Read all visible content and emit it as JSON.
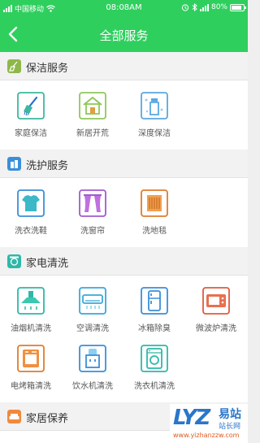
{
  "status_bar": {
    "carrier": "中国移动",
    "time": "08:08AM",
    "battery": "80%"
  },
  "header": {
    "title": "全部服务"
  },
  "sections": [
    {
      "title": "保洁服务",
      "icon": "broom-icon",
      "color": "#8fb84a",
      "items": [
        {
          "label": "家庭保洁",
          "icon": "broom-icon"
        },
        {
          "label": "新居开荒",
          "icon": "house-icon"
        },
        {
          "label": "深度保洁",
          "icon": "spray-bottle-icon"
        }
      ]
    },
    {
      "title": "洗护服务",
      "icon": "detergent-icon",
      "color": "#3a8fd8",
      "items": [
        {
          "label": "洗衣洗鞋",
          "icon": "shirt-icon"
        },
        {
          "label": "洗窗帘",
          "icon": "curtain-icon"
        },
        {
          "label": "洗地毯",
          "icon": "carpet-icon"
        }
      ]
    },
    {
      "title": "家电清洗",
      "icon": "washer-icon",
      "color": "#2fb8a8",
      "items": [
        {
          "label": "油烟机清洗",
          "icon": "range-hood-icon"
        },
        {
          "label": "空调清洗",
          "icon": "air-conditioner-icon"
        },
        {
          "label": "冰箱除臭",
          "icon": "fridge-icon"
        },
        {
          "label": "微波炉清洗",
          "icon": "microwave-icon"
        },
        {
          "label": "电烤箱清洗",
          "icon": "oven-icon"
        },
        {
          "label": "饮水机清洗",
          "icon": "water-dispenser-icon"
        },
        {
          "label": "洗衣机清洗",
          "icon": "washing-machine-icon"
        }
      ]
    },
    {
      "title": "家居保养",
      "icon": "sofa-icon",
      "color": "#f08a3c",
      "items": []
    }
  ],
  "watermark": {
    "logo": "LYZ",
    "name": "易站",
    "subtitle": "站长网",
    "url": "www.yizhanzzw.com"
  },
  "colors": {
    "accent": "#2fcf5e",
    "section_bg": "#f2f2f2",
    "icon_green": "#3cb8a0",
    "icon_blue": "#3a8fd8",
    "icon_purple": "#a25ad0",
    "icon_orange": "#e07c2c",
    "icon_red": "#e25a3e"
  }
}
